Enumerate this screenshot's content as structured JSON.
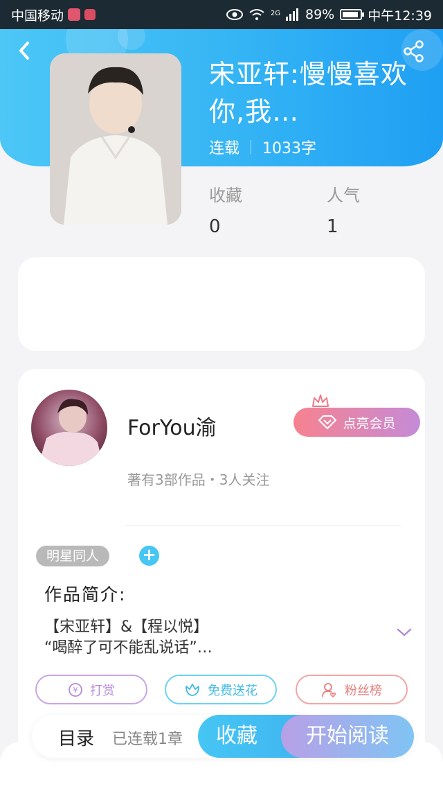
{
  "status_bar": {
    "carrier": "中国移动",
    "network": "2G",
    "battery": "89%",
    "time": "中午12:39"
  },
  "book": {
    "title": "宋亚轩:慢慢喜欢你,我…",
    "status": "连载",
    "word_count": "1033字",
    "stats": {
      "favorites_label": "收藏",
      "favorites_value": "0",
      "popularity_label": "人气",
      "popularity_value": "1"
    }
  },
  "author": {
    "name": "ForYou渝",
    "stats": "著有3部作品・3人关注",
    "vip_button": "点亮会员"
  },
  "tags": [
    "明星同人"
  ],
  "intro": {
    "heading": "作品简介:",
    "line1": "【宋亚轩】&【程以悦】",
    "line2": "“喝醉了可不能乱说话”…"
  },
  "actions": {
    "reward": "打赏",
    "flower": "免费送花",
    "fans": "粉丝榜"
  },
  "bottom_bar": {
    "toc": "目录",
    "chapters": "已连载1章",
    "collect": "收藏",
    "read": "开始阅读"
  },
  "colors": {
    "header_blue": "#34b4f4",
    "accent_cyan": "#47c6f4",
    "vip_gradient_start": "#f7828f",
    "vip_gradient_end": "#c58bd7"
  }
}
